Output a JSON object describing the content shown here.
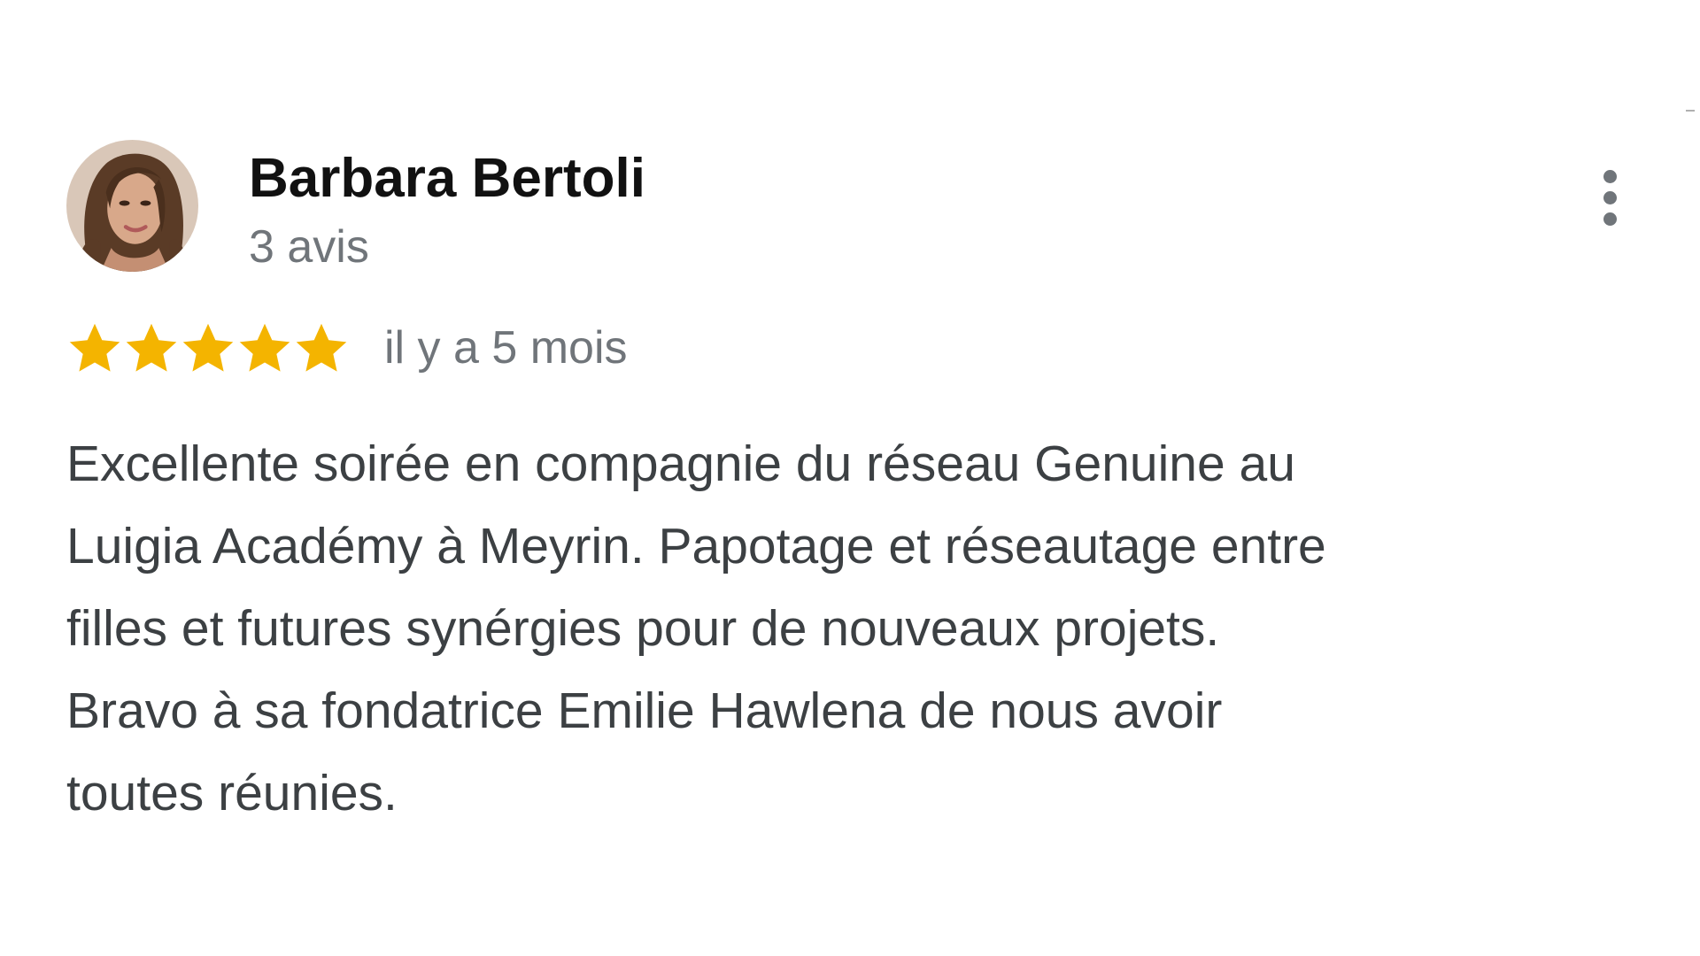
{
  "review": {
    "author_name": "Barbara Bertoli",
    "review_count": "3 avis",
    "rating": 5,
    "rating_max": 5,
    "time_ago": "il y a 5 mois",
    "text_lines": [
      "Excellente soirée en compagnie du réseau Genuine au",
      "Luigia Académy à Meyrin. Papotage et réseautage entre",
      "filles et futures synérgies pour de nouveaux projets.",
      "Bravo à sa fondatrice Emilie Hawlena de nous avoir",
      "toutes réunies."
    ]
  },
  "icons": {
    "avatar": "user-photo",
    "menu": "more-vertical-icon",
    "star": "star-icon"
  },
  "colors": {
    "star": "#f4b400",
    "name": "#111111",
    "secondary": "#70757a",
    "body_text": "#3c4043"
  }
}
